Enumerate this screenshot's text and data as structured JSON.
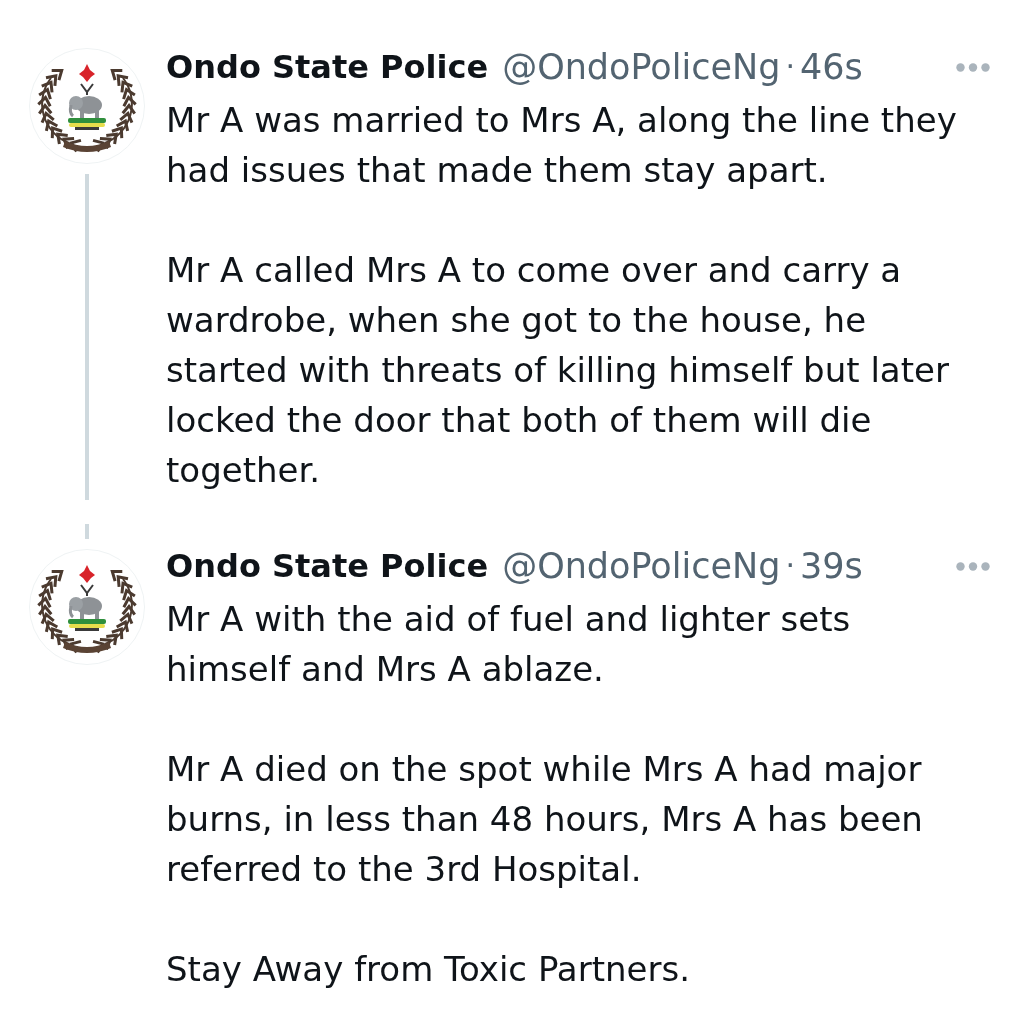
{
  "tweets": [
    {
      "author": {
        "name": "Ondo State Police",
        "handle": "@OndoPoliceNg",
        "separator": "·",
        "time": "46s"
      },
      "line_above": false,
      "line_below": true,
      "paragraphs": [
        "Mr A was married to Mrs A, along the line they had issues that made them stay apart.",
        "Mr A called Mrs A to come over and carry a wardrobe, when she got to the house, he started with threats of killing himself but later locked the door that both of them will die together."
      ]
    },
    {
      "author": {
        "name": "Ondo State Police",
        "handle": "@OndoPoliceNg",
        "separator": "·",
        "time": "39s"
      },
      "line_above": true,
      "line_below": false,
      "paragraphs": [
        "Mr A with the aid of fuel and lighter sets himself and Mrs A ablaze.",
        "Mr A died on the spot while Mrs A had major burns, in less than 48 hours, Mrs A has been referred to the 3rd Hospital.",
        "Stay Away from Toxic Partners."
      ]
    }
  ]
}
